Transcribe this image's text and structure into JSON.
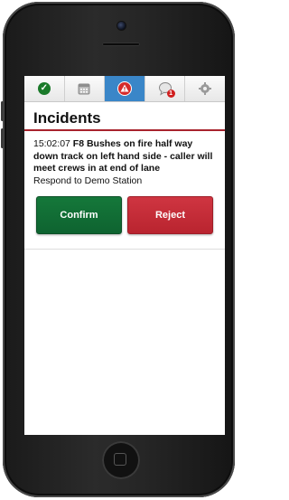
{
  "tabs": [
    {
      "icon": "check-circle-icon",
      "active": false
    },
    {
      "icon": "calendar-icon",
      "active": false
    },
    {
      "icon": "warning-icon",
      "active": true
    },
    {
      "icon": "chat-bubble-icon",
      "active": false,
      "badge": "1"
    },
    {
      "icon": "gear-icon",
      "active": false
    }
  ],
  "page": {
    "title": "Incidents"
  },
  "incident": {
    "time": "15:02:07",
    "description": "F8 Bushes on fire half way down track on left hand side - caller will meet crews in at end of lane",
    "respond": "Respond to Demo Station"
  },
  "actions": {
    "confirm_label": "Confirm",
    "reject_label": "Reject"
  },
  "colors": {
    "tab_active": "#3a86c8",
    "confirm": "#15783a",
    "reject": "#cf3541",
    "heading_rule": "#a8232d",
    "badge": "#d01f1f"
  }
}
